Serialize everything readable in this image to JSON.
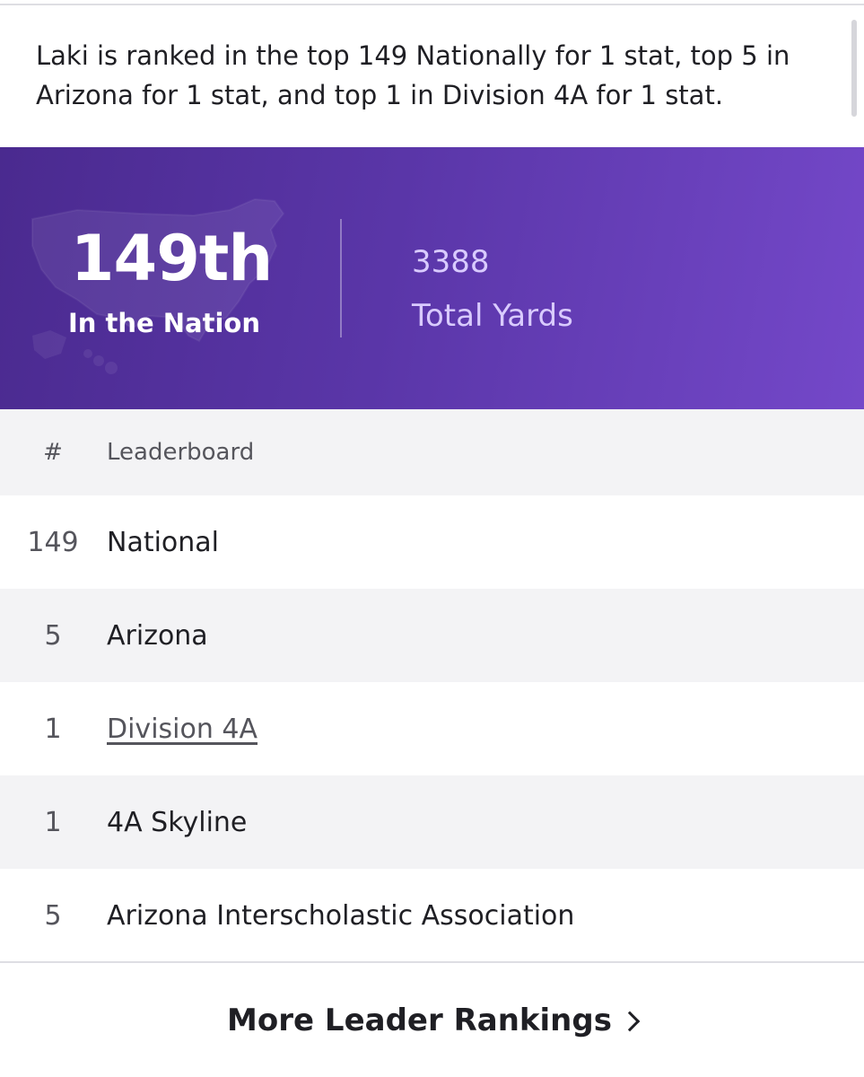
{
  "summary": {
    "text": "Laki is ranked in the top 149 Nationally for 1 stat, top 5 in Arizona for 1 stat, and top 1 in Division 4A for 1 stat."
  },
  "hero": {
    "rank": "149th",
    "rank_caption": "In the Nation",
    "stat_value": "3388",
    "stat_label": "Total Yards",
    "map_icon": "usa-map-icon",
    "colors": {
      "gradient_start": "#4a2a8f",
      "gradient_end": "#7448c9",
      "stat_text": "#d9cbff"
    }
  },
  "leaderboard": {
    "header": {
      "num": "#",
      "name": "Leaderboard"
    },
    "rows": [
      {
        "num": "149",
        "name": "National",
        "link": false
      },
      {
        "num": "5",
        "name": "Arizona",
        "link": false
      },
      {
        "num": "1",
        "name": "Division 4A",
        "link": true
      },
      {
        "num": "1",
        "name": "4A Skyline",
        "link": false
      },
      {
        "num": "5",
        "name": "Arizona Interscholastic Association",
        "link": false
      }
    ]
  },
  "footer": {
    "more_label": "More Leader Rankings",
    "chevron_icon": "chevron-right-icon"
  }
}
